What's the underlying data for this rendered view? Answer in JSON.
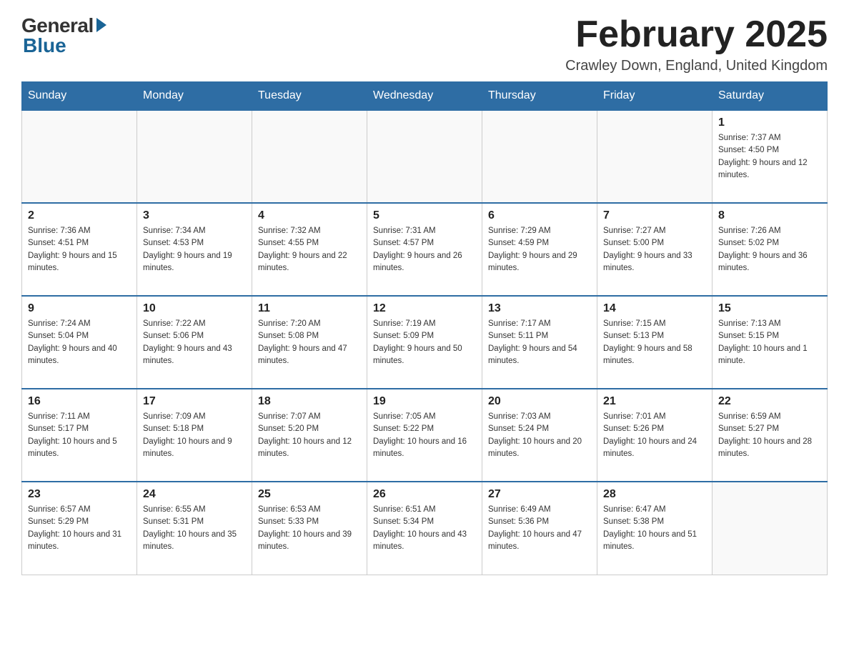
{
  "header": {
    "logo_general": "General",
    "logo_blue": "Blue",
    "month_title": "February 2025",
    "location": "Crawley Down, England, United Kingdom"
  },
  "days_of_week": [
    "Sunday",
    "Monday",
    "Tuesday",
    "Wednesday",
    "Thursday",
    "Friday",
    "Saturday"
  ],
  "weeks": [
    {
      "days": [
        {
          "date": "",
          "sunrise": "",
          "sunset": "",
          "daylight": ""
        },
        {
          "date": "",
          "sunrise": "",
          "sunset": "",
          "daylight": ""
        },
        {
          "date": "",
          "sunrise": "",
          "sunset": "",
          "daylight": ""
        },
        {
          "date": "",
          "sunrise": "",
          "sunset": "",
          "daylight": ""
        },
        {
          "date": "",
          "sunrise": "",
          "sunset": "",
          "daylight": ""
        },
        {
          "date": "",
          "sunrise": "",
          "sunset": "",
          "daylight": ""
        },
        {
          "date": "1",
          "sunrise": "Sunrise: 7:37 AM",
          "sunset": "Sunset: 4:50 PM",
          "daylight": "Daylight: 9 hours and 12 minutes."
        }
      ]
    },
    {
      "days": [
        {
          "date": "2",
          "sunrise": "Sunrise: 7:36 AM",
          "sunset": "Sunset: 4:51 PM",
          "daylight": "Daylight: 9 hours and 15 minutes."
        },
        {
          "date": "3",
          "sunrise": "Sunrise: 7:34 AM",
          "sunset": "Sunset: 4:53 PM",
          "daylight": "Daylight: 9 hours and 19 minutes."
        },
        {
          "date": "4",
          "sunrise": "Sunrise: 7:32 AM",
          "sunset": "Sunset: 4:55 PM",
          "daylight": "Daylight: 9 hours and 22 minutes."
        },
        {
          "date": "5",
          "sunrise": "Sunrise: 7:31 AM",
          "sunset": "Sunset: 4:57 PM",
          "daylight": "Daylight: 9 hours and 26 minutes."
        },
        {
          "date": "6",
          "sunrise": "Sunrise: 7:29 AM",
          "sunset": "Sunset: 4:59 PM",
          "daylight": "Daylight: 9 hours and 29 minutes."
        },
        {
          "date": "7",
          "sunrise": "Sunrise: 7:27 AM",
          "sunset": "Sunset: 5:00 PM",
          "daylight": "Daylight: 9 hours and 33 minutes."
        },
        {
          "date": "8",
          "sunrise": "Sunrise: 7:26 AM",
          "sunset": "Sunset: 5:02 PM",
          "daylight": "Daylight: 9 hours and 36 minutes."
        }
      ]
    },
    {
      "days": [
        {
          "date": "9",
          "sunrise": "Sunrise: 7:24 AM",
          "sunset": "Sunset: 5:04 PM",
          "daylight": "Daylight: 9 hours and 40 minutes."
        },
        {
          "date": "10",
          "sunrise": "Sunrise: 7:22 AM",
          "sunset": "Sunset: 5:06 PM",
          "daylight": "Daylight: 9 hours and 43 minutes."
        },
        {
          "date": "11",
          "sunrise": "Sunrise: 7:20 AM",
          "sunset": "Sunset: 5:08 PM",
          "daylight": "Daylight: 9 hours and 47 minutes."
        },
        {
          "date": "12",
          "sunrise": "Sunrise: 7:19 AM",
          "sunset": "Sunset: 5:09 PM",
          "daylight": "Daylight: 9 hours and 50 minutes."
        },
        {
          "date": "13",
          "sunrise": "Sunrise: 7:17 AM",
          "sunset": "Sunset: 5:11 PM",
          "daylight": "Daylight: 9 hours and 54 minutes."
        },
        {
          "date": "14",
          "sunrise": "Sunrise: 7:15 AM",
          "sunset": "Sunset: 5:13 PM",
          "daylight": "Daylight: 9 hours and 58 minutes."
        },
        {
          "date": "15",
          "sunrise": "Sunrise: 7:13 AM",
          "sunset": "Sunset: 5:15 PM",
          "daylight": "Daylight: 10 hours and 1 minute."
        }
      ]
    },
    {
      "days": [
        {
          "date": "16",
          "sunrise": "Sunrise: 7:11 AM",
          "sunset": "Sunset: 5:17 PM",
          "daylight": "Daylight: 10 hours and 5 minutes."
        },
        {
          "date": "17",
          "sunrise": "Sunrise: 7:09 AM",
          "sunset": "Sunset: 5:18 PM",
          "daylight": "Daylight: 10 hours and 9 minutes."
        },
        {
          "date": "18",
          "sunrise": "Sunrise: 7:07 AM",
          "sunset": "Sunset: 5:20 PM",
          "daylight": "Daylight: 10 hours and 12 minutes."
        },
        {
          "date": "19",
          "sunrise": "Sunrise: 7:05 AM",
          "sunset": "Sunset: 5:22 PM",
          "daylight": "Daylight: 10 hours and 16 minutes."
        },
        {
          "date": "20",
          "sunrise": "Sunrise: 7:03 AM",
          "sunset": "Sunset: 5:24 PM",
          "daylight": "Daylight: 10 hours and 20 minutes."
        },
        {
          "date": "21",
          "sunrise": "Sunrise: 7:01 AM",
          "sunset": "Sunset: 5:26 PM",
          "daylight": "Daylight: 10 hours and 24 minutes."
        },
        {
          "date": "22",
          "sunrise": "Sunrise: 6:59 AM",
          "sunset": "Sunset: 5:27 PM",
          "daylight": "Daylight: 10 hours and 28 minutes."
        }
      ]
    },
    {
      "days": [
        {
          "date": "23",
          "sunrise": "Sunrise: 6:57 AM",
          "sunset": "Sunset: 5:29 PM",
          "daylight": "Daylight: 10 hours and 31 minutes."
        },
        {
          "date": "24",
          "sunrise": "Sunrise: 6:55 AM",
          "sunset": "Sunset: 5:31 PM",
          "daylight": "Daylight: 10 hours and 35 minutes."
        },
        {
          "date": "25",
          "sunrise": "Sunrise: 6:53 AM",
          "sunset": "Sunset: 5:33 PM",
          "daylight": "Daylight: 10 hours and 39 minutes."
        },
        {
          "date": "26",
          "sunrise": "Sunrise: 6:51 AM",
          "sunset": "Sunset: 5:34 PM",
          "daylight": "Daylight: 10 hours and 43 minutes."
        },
        {
          "date": "27",
          "sunrise": "Sunrise: 6:49 AM",
          "sunset": "Sunset: 5:36 PM",
          "daylight": "Daylight: 10 hours and 47 minutes."
        },
        {
          "date": "28",
          "sunrise": "Sunrise: 6:47 AM",
          "sunset": "Sunset: 5:38 PM",
          "daylight": "Daylight: 10 hours and 51 minutes."
        },
        {
          "date": "",
          "sunrise": "",
          "sunset": "",
          "daylight": ""
        }
      ]
    }
  ]
}
